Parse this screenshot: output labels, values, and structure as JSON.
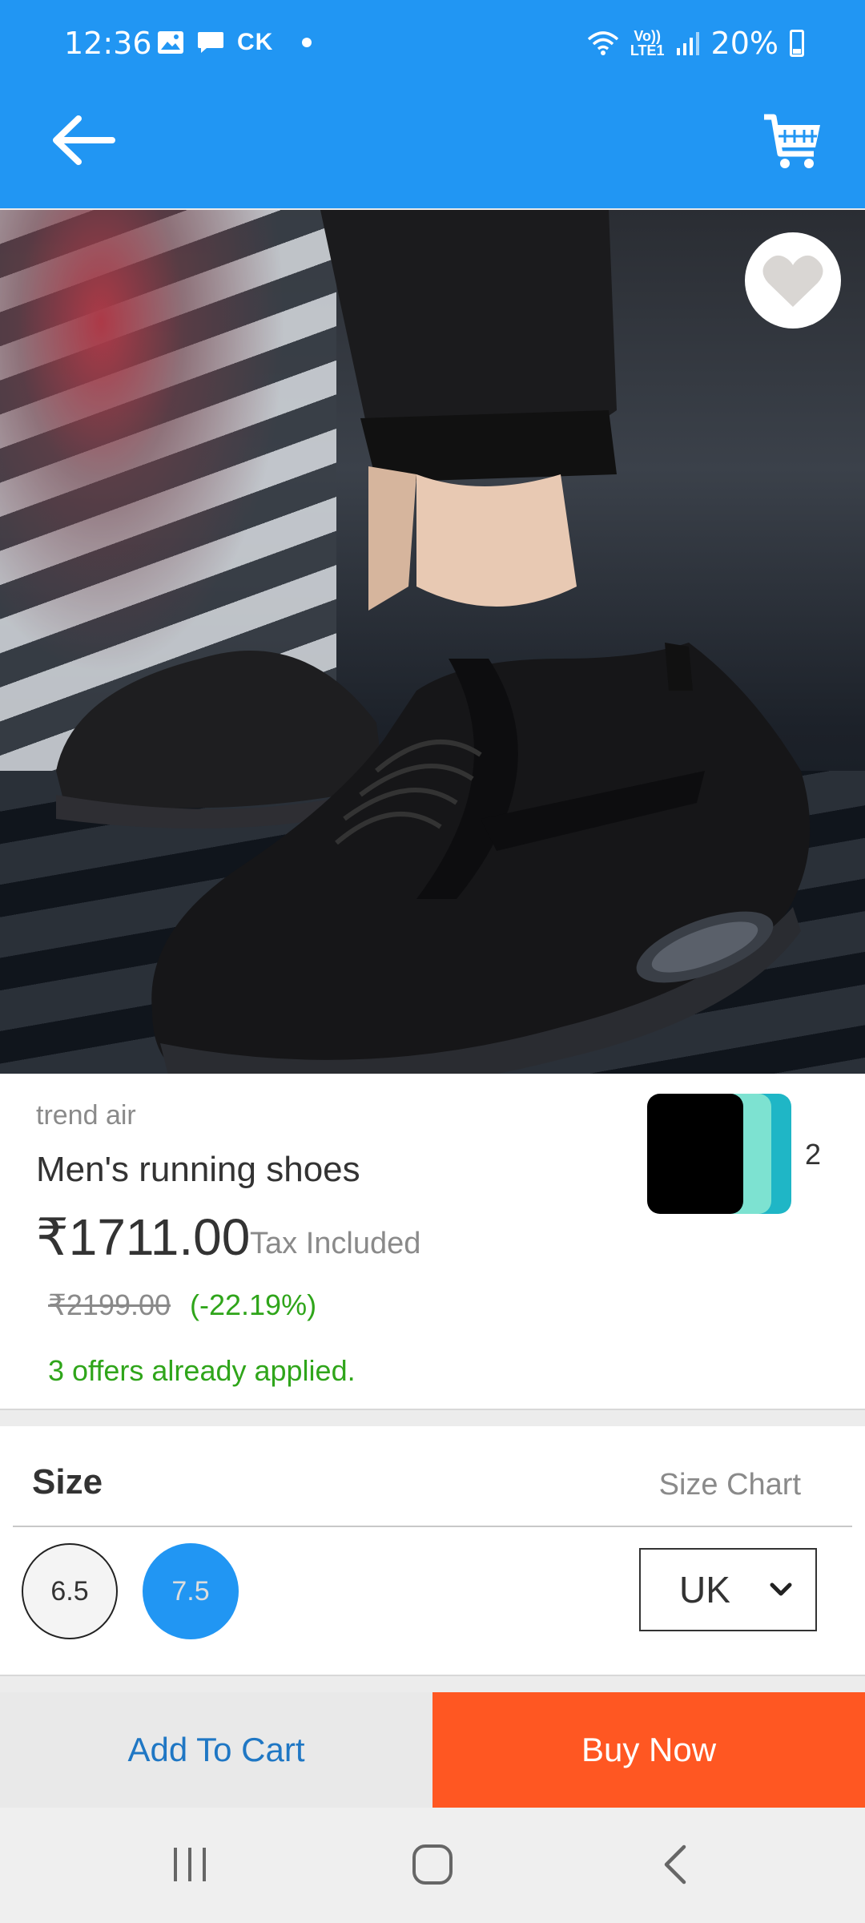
{
  "status_bar": {
    "time": "12:36",
    "carrier_tag": "CK",
    "network_label_top": "Vo))",
    "network_label_bottom": "LTE1",
    "battery": "20%"
  },
  "app_bar": {
    "back_icon": "arrow-left-icon",
    "cart_icon": "shopping-cart-icon",
    "color": "#2196f3"
  },
  "product": {
    "brand": "trend air",
    "name": "Men's running shoes",
    "price": "₹1711.00",
    "tax_note": "Tax Included",
    "original_price": "₹2199.00",
    "discount": "(-22.19%)",
    "offers": "3 offers already applied.",
    "color_variants_count": "2",
    "favorite_icon": "heart-icon"
  },
  "size": {
    "title": "Size",
    "chart_link": "Size Chart",
    "options": [
      "6.5",
      "7.5"
    ],
    "selected": "7.5",
    "unit": "UK"
  },
  "actions": {
    "add_to_cart": "Add To Cart",
    "buy_now": "Buy Now",
    "accent": "#ff5722"
  },
  "system_nav": {
    "recents_icon": "recents-icon",
    "home_icon": "home-icon",
    "back_icon": "back-chevron-icon"
  }
}
